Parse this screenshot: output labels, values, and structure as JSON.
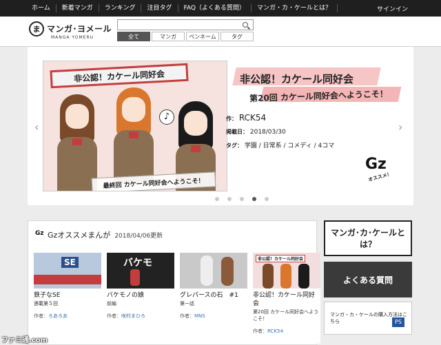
{
  "topnav": {
    "items": [
      "ホーム",
      "新着マンガ",
      "ランキング",
      "注目タグ",
      "FAQ（よくある質問）",
      "マンガ・カ・ケールとは？"
    ],
    "signin": "サインイン"
  },
  "header": {
    "logo_mark": "ま",
    "logo_text": "マンガ･ヨメール",
    "logo_sub": "MANGA YOMERU",
    "search": {
      "placeholder": "",
      "tabs": [
        "全て",
        "マンガ",
        "ペンネーム",
        "タグ"
      ],
      "active_tab": 0
    }
  },
  "hero": {
    "image_banner": "非公認！カケール同好会",
    "image_caption": "最終回 カケール同好会へようこそ！",
    "title": "非公認！カケール同好会",
    "subtitle": "第20回 カケール同好会へようこそ！",
    "author_label": "作：",
    "author": "RCK54",
    "date_label": "掲載日：",
    "date": "2018/03/30",
    "tags_label": "タグ：",
    "tags": "学園 / 日常系 / コメディ / 4コマ",
    "badge": "Gz",
    "badge_sub": "オススメ！",
    "slides": 5,
    "active_slide": 3
  },
  "recommend": {
    "heading": "Gzオススメまんが",
    "date": "2018/04/06更新",
    "cards": [
      {
        "title": "鉄子なSE",
        "meta": "連載第５回",
        "author_label": "作者：",
        "author": "ろあろあ",
        "thumb_text": "SE"
      },
      {
        "title": "バケモノの娘",
        "meta": "前編",
        "author_label": "作者：",
        "author": "咲村まひろ",
        "thumb_text": "バケモ"
      },
      {
        "title": "グレパースの石　#1",
        "meta": "第一話",
        "author_label": "作者：",
        "author": "MNS",
        "thumb_text": ""
      },
      {
        "title": "非公認！カケール同好会",
        "meta": "第20回 カケール同好会へようこそ！",
        "author_label": "作者：",
        "author": "RCK54",
        "thumb_text": "非公認！カケール同好会"
      }
    ]
  },
  "side": {
    "banner1": "マンガ･カ･ケールとは？",
    "banner2": "よくある質問",
    "banner3": "マンガ・カ・ケールの購入方法はこちら"
  },
  "watermark": "ファミ通.com"
}
